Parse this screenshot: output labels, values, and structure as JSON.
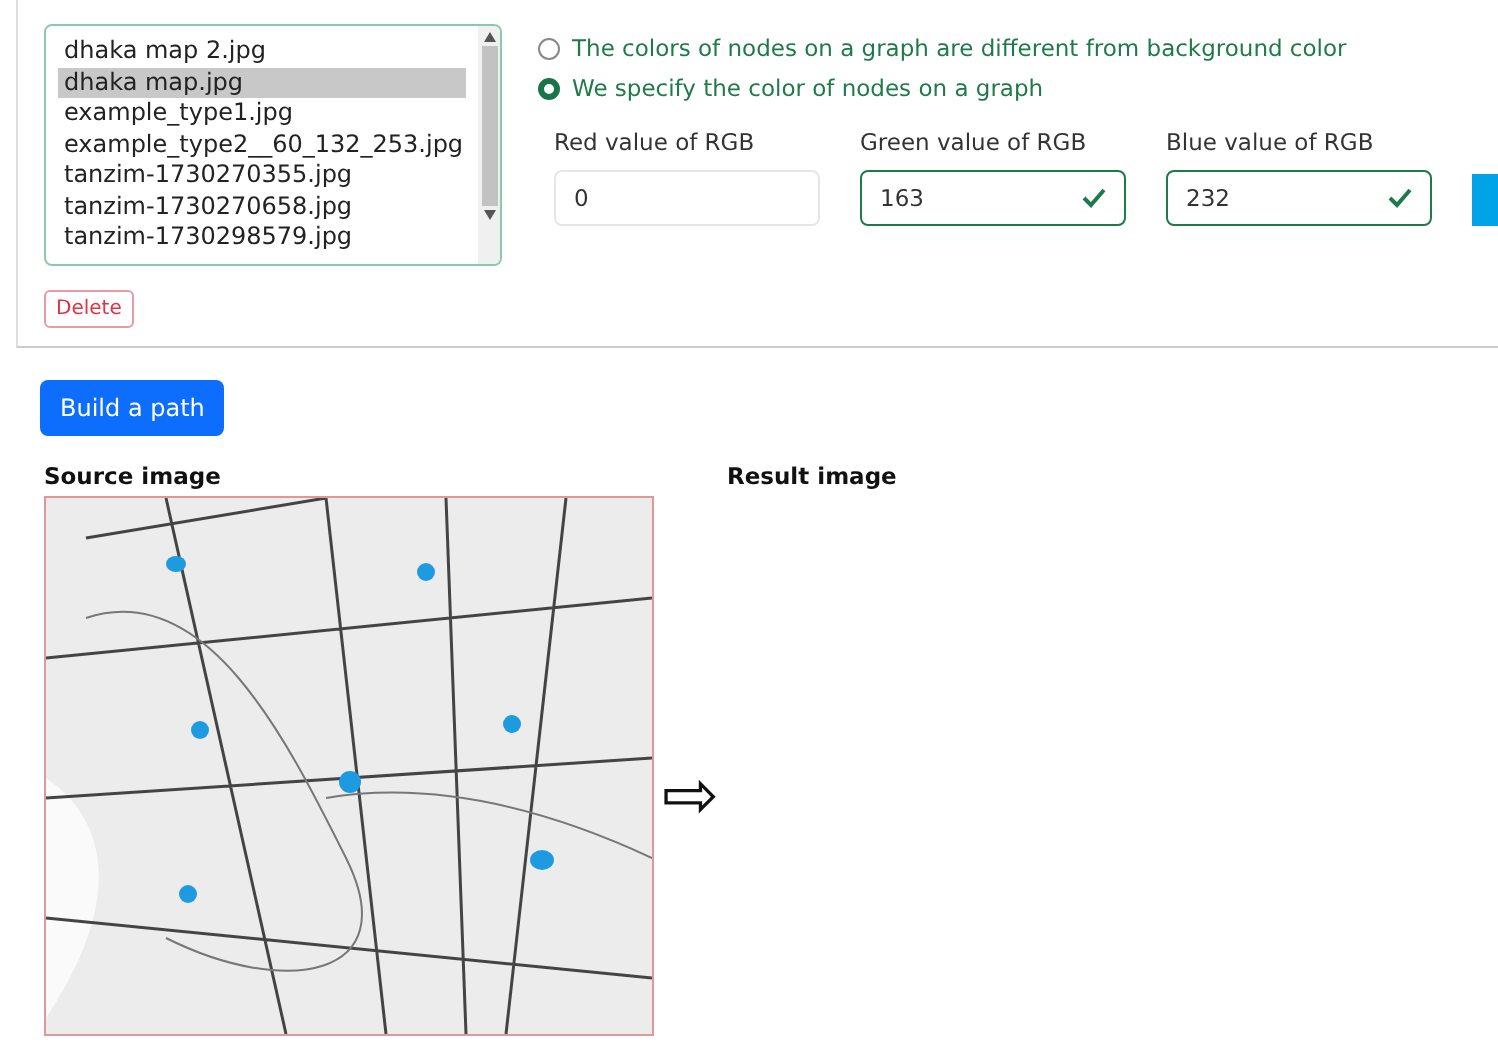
{
  "file_list": {
    "items": [
      {
        "label": "dhaka map 2.jpg",
        "selected": false
      },
      {
        "label": "dhaka map.jpg",
        "selected": true
      },
      {
        "label": "example_type1.jpg",
        "selected": false
      },
      {
        "label": "example_type2__60_132_253.jpg",
        "selected": false
      },
      {
        "label": "tanzim-1730270355.jpg",
        "selected": false
      },
      {
        "label": "tanzim-1730270658.jpg",
        "selected": false
      },
      {
        "label": "tanzim-1730298579.jpg",
        "selected": false
      }
    ]
  },
  "delete_button": "Delete",
  "node_color_mode": [
    {
      "label": "The colors of nodes on a graph are different from background color",
      "selected": false
    },
    {
      "label": "We specify the color of nodes on a graph",
      "selected": true
    }
  ],
  "rgb_fields": [
    {
      "label": "Red value of RGB",
      "value": "0",
      "valid": false
    },
    {
      "label": "Green value of RGB",
      "value": "163",
      "valid": true
    },
    {
      "label": "Blue value of RGB",
      "value": "232",
      "valid": true
    }
  ],
  "color_preview": {
    "color": "#00a3e8"
  },
  "build_button": "Build a path",
  "source_image": {
    "title": "Source image",
    "kind": "picture"
  },
  "arrow": "⇨",
  "result_image": {
    "title": "Result image"
  }
}
